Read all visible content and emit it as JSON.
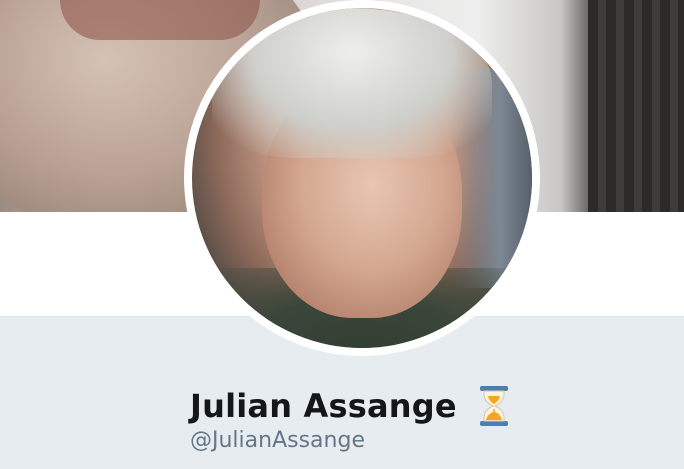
{
  "profile": {
    "display_name": "Julian Assange",
    "handle": "@JulianAssange",
    "name_emoji": "hourglass-icon"
  },
  "colors": {
    "profile_background": "#e6ecf0",
    "name_text": "#14171a",
    "handle_text": "#657786",
    "hourglass_frame": "#4a7fb0",
    "hourglass_sand": "#f4a522"
  },
  "images": {
    "banner": "header-photo",
    "avatar": "profile-photo"
  }
}
